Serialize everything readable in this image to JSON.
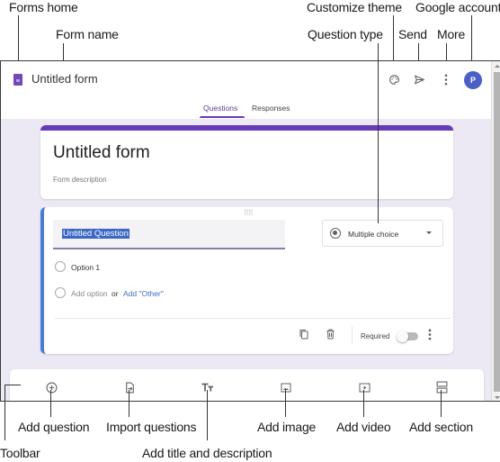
{
  "callouts": {
    "forms_home": "Forms home",
    "form_name": "Form name",
    "customize_theme": "Customize theme",
    "question_type": "Question type",
    "send": "Send",
    "more": "More",
    "google_account": "Google account",
    "add_question": "Add question",
    "import_questions": "Import questions",
    "add_title_description": "Add title and description",
    "add_image": "Add image",
    "add_video": "Add video",
    "add_section": "Add section",
    "toolbar": "Toolbar"
  },
  "header": {
    "form_name": "Untitled form",
    "avatar_initial": "P",
    "icons": [
      "palette-icon",
      "send-icon",
      "more-vert-icon"
    ]
  },
  "tabs": [
    {
      "label": "Questions",
      "active": true
    },
    {
      "label": "Responses",
      "active": false
    }
  ],
  "title_card": {
    "title": "Untitled form",
    "description_placeholder": "Form description"
  },
  "question_card": {
    "question_text": "Untitled Question",
    "question_type": "Multiple choice",
    "options": [
      "Option 1"
    ],
    "add_option": "Add option",
    "or": "or",
    "add_other": "Add \"Other\"",
    "required_label": "Required",
    "required": false
  },
  "toolbar": {
    "items": [
      {
        "name": "add-question",
        "icon": "add-circle-icon"
      },
      {
        "name": "import-questions",
        "icon": "import-icon"
      },
      {
        "name": "add-title-description",
        "icon": "title-icon"
      },
      {
        "name": "add-image",
        "icon": "image-icon"
      },
      {
        "name": "add-video",
        "icon": "video-icon"
      },
      {
        "name": "add-section",
        "icon": "section-icon"
      }
    ]
  },
  "colors": {
    "accent": "#673ab7",
    "question_border": "#4b7bd4",
    "avatar": "#4b5fc7",
    "canvas_bg": "#ece8f4",
    "link": "#3f6cc4"
  }
}
